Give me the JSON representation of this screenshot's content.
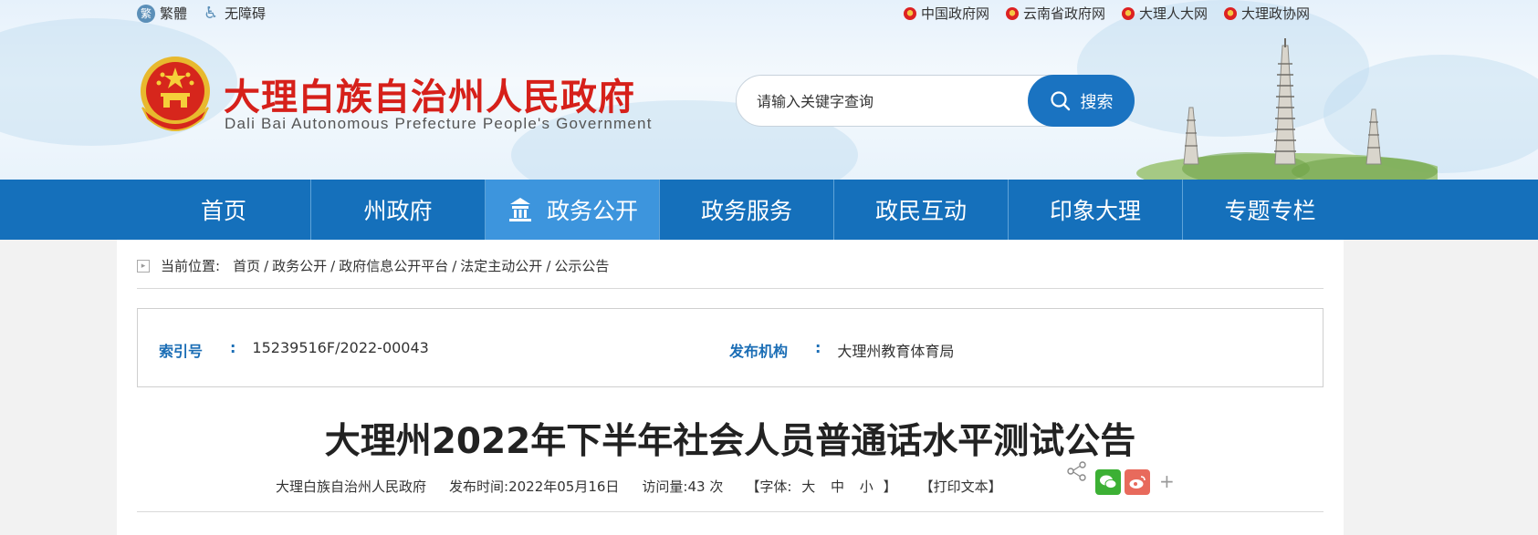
{
  "topbar": {
    "traditional_label": "繁體",
    "accessibility_label": "无障碍",
    "links": [
      {
        "label": "中国政府网"
      },
      {
        "label": "云南省政府网"
      },
      {
        "label": "大理人大网"
      },
      {
        "label": "大理政协网"
      }
    ]
  },
  "header": {
    "title": "大理白族自治州人民政府",
    "subtitle": "Dali Bai Autonomous Prefecture People's Government"
  },
  "search": {
    "placeholder": "请输入关键字查询",
    "button_label": "搜索"
  },
  "nav": {
    "items": [
      {
        "label": "首页"
      },
      {
        "label": "州政府"
      },
      {
        "label": "政务公开",
        "active": true
      },
      {
        "label": "政务服务"
      },
      {
        "label": "政民互动"
      },
      {
        "label": "印象大理"
      },
      {
        "label": "专题专栏"
      }
    ]
  },
  "breadcrumb": {
    "prefix": "当前位置:",
    "items": [
      "首页",
      "政务公开",
      "政府信息公开平台",
      "法定主动公开",
      "公示公告"
    ],
    "separator": "/"
  },
  "meta": {
    "index_label": "索引号",
    "index_value": "15239516F/2022-00043",
    "publisher_label": "发布机构",
    "publisher_value": "大理州教育体育局",
    "colon": ":"
  },
  "article": {
    "title": "大理州2022年下半年社会人员普通话水平测试公告",
    "source": "大理白族自治州人民政府",
    "publish_time": "发布时间:2022年05月16日",
    "views": "访问量:43 次",
    "font_size_prefix": "【字体:",
    "font_large": "大",
    "font_medium": "中",
    "font_small": "小",
    "font_size_suffix": "】",
    "print_label": "【打印文本】"
  },
  "colors": {
    "nav_bg": "#1570bb",
    "nav_active": "#3d95dd",
    "title_red": "#d6201a",
    "label_blue": "#1a6db5"
  }
}
